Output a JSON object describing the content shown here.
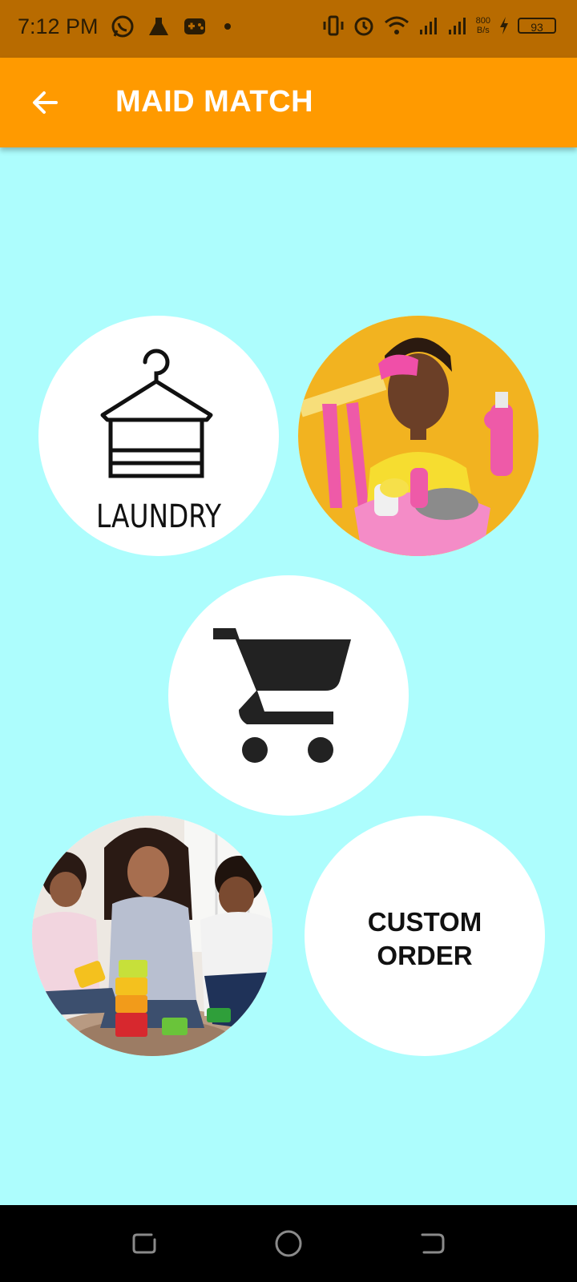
{
  "status_bar": {
    "time": "7:12 PM",
    "speed_value": "800",
    "speed_unit": "B/s",
    "battery": "93",
    "icons": [
      "whatsapp-icon",
      "flask-icon",
      "game-icon",
      "dot-icon",
      "vibrate-icon",
      "alarm-icon",
      "wifi-icon",
      "signal-icon",
      "signal-icon",
      "charging-icon",
      "battery-icon"
    ]
  },
  "app_bar": {
    "title": "MAID MATCH",
    "back_icon": "arrow-back-icon"
  },
  "tiles": {
    "laundry": {
      "label": "LAUNDRY",
      "icon": "hanger-icon"
    },
    "cleaning": {
      "image": "woman-with-cleaning-supplies"
    },
    "shopping": {
      "icon": "shopping-cart-icon"
    },
    "childcare": {
      "image": "woman-playing-with-children"
    },
    "custom": {
      "label_line1": "CUSTOM",
      "label_line2": "ORDER"
    }
  },
  "colors": {
    "background": "#adfdfd",
    "app_bar": "#ff9a00",
    "status_bar": "#b86b00",
    "tile": "#ffffff"
  },
  "nav_bar": {
    "icons": [
      "recents-icon",
      "home-icon",
      "back-icon"
    ]
  }
}
